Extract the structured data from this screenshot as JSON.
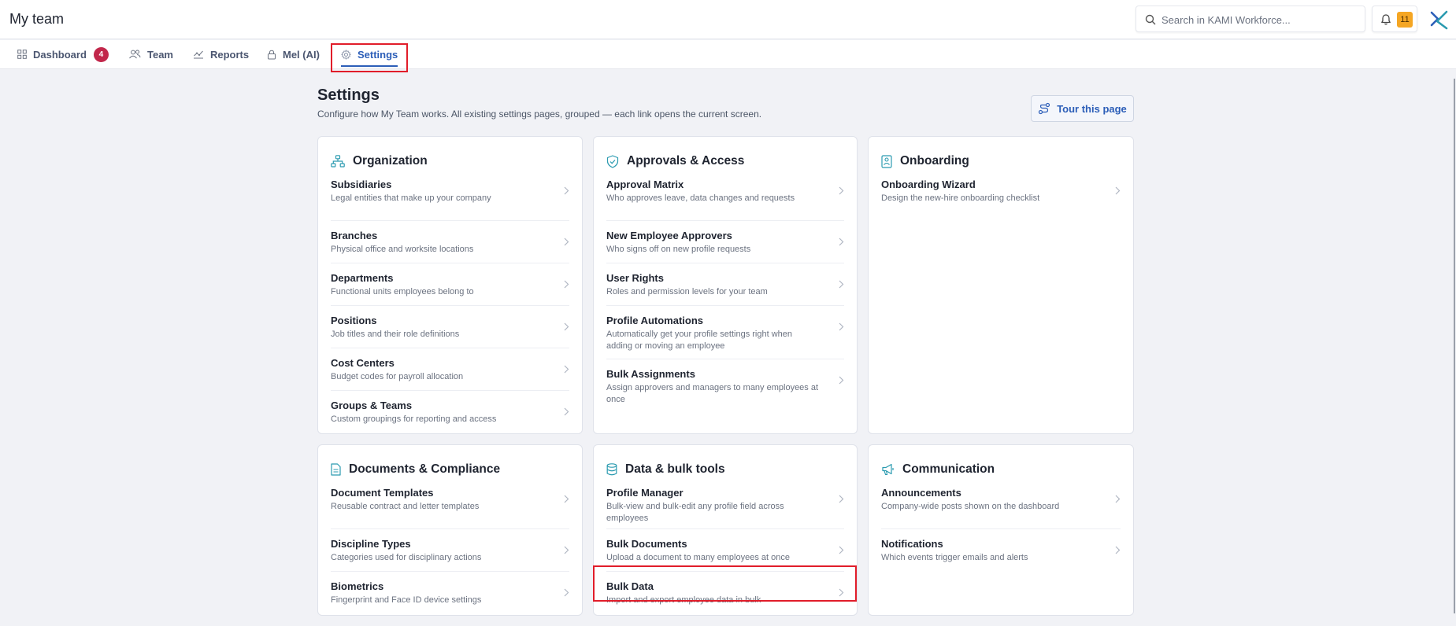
{
  "header": {
    "title": "My team",
    "search_placeholder": "Search in KAMI Workforce...",
    "notification_count": "11"
  },
  "tabs": [
    {
      "label": "Dashboard",
      "count": "4",
      "icon": "grid-icon"
    },
    {
      "label": "Team",
      "icon": "people-icon"
    },
    {
      "label": "Reports",
      "icon": "chart-icon"
    },
    {
      "label": "Mel (AI)",
      "icon": "lock-icon"
    },
    {
      "label": "Settings",
      "icon": "gear-icon",
      "active": true
    }
  ],
  "page": {
    "title": "Settings",
    "subtitle": "Configure how My Team works. All existing settings pages, grouped — each link opens the current screen.",
    "tour_label": "Tour this page"
  },
  "cards": [
    {
      "title": "Organization",
      "icon": "org-chart-icon",
      "items": [
        {
          "title": "Subsidiaries",
          "desc": "Legal entities that make up your company"
        },
        {
          "title": "Branches",
          "desc": "Physical office and worksite locations"
        },
        {
          "title": "Departments",
          "desc": "Functional units employees belong to"
        },
        {
          "title": "Positions",
          "desc": "Job titles and their role definitions"
        },
        {
          "title": "Cost Centers",
          "desc": "Budget codes for payroll allocation"
        },
        {
          "title": "Groups & Teams",
          "desc": "Custom groupings for reporting and access"
        }
      ]
    },
    {
      "title": "Approvals & Access",
      "icon": "shield-check-icon",
      "items": [
        {
          "title": "Approval Matrix",
          "desc": "Who approves leave, data changes and requests"
        },
        {
          "title": "New Employee Approvers",
          "desc": "Who signs off on new profile requests"
        },
        {
          "title": "User Rights",
          "desc": "Roles and permission levels for your team"
        },
        {
          "title": "Profile Automations",
          "desc": "Automatically get your profile settings right when adding or moving an employee"
        },
        {
          "title": "Bulk Assignments",
          "desc": "Assign approvers and managers to many employees at once"
        }
      ]
    },
    {
      "title": "Onboarding",
      "icon": "id-badge-icon",
      "items": [
        {
          "title": "Onboarding Wizard",
          "desc": "Design the new-hire onboarding checklist"
        }
      ]
    },
    {
      "title": "Documents & Compliance",
      "icon": "document-icon",
      "items": [
        {
          "title": "Document Templates",
          "desc": "Reusable contract and letter templates"
        },
        {
          "title": "Discipline Types",
          "desc": "Categories used for disciplinary actions"
        },
        {
          "title": "Biometrics",
          "desc": "Fingerprint and Face ID device settings"
        }
      ]
    },
    {
      "title": "Data & bulk tools",
      "icon": "database-icon",
      "items": [
        {
          "title": "Profile Manager",
          "desc": "Bulk-view and bulk-edit any profile field across employees"
        },
        {
          "title": "Bulk Documents",
          "desc": "Upload a document to many employees at once"
        },
        {
          "title": "Bulk Data",
          "desc": "Import and export employee data in bulk"
        }
      ]
    },
    {
      "title": "Communication",
      "icon": "megaphone-icon",
      "items": [
        {
          "title": "Announcements",
          "desc": "Company-wide posts shown on the dashboard"
        },
        {
          "title": "Notifications",
          "desc": "Which events trigger emails and alerts"
        }
      ]
    }
  ],
  "colors": {
    "accent": "#2c5eb8",
    "icon_teal": "#2b9bb0",
    "badge_red": "#c2274b",
    "notif_amber": "#f5a623",
    "highlight": "#e11d2a"
  }
}
